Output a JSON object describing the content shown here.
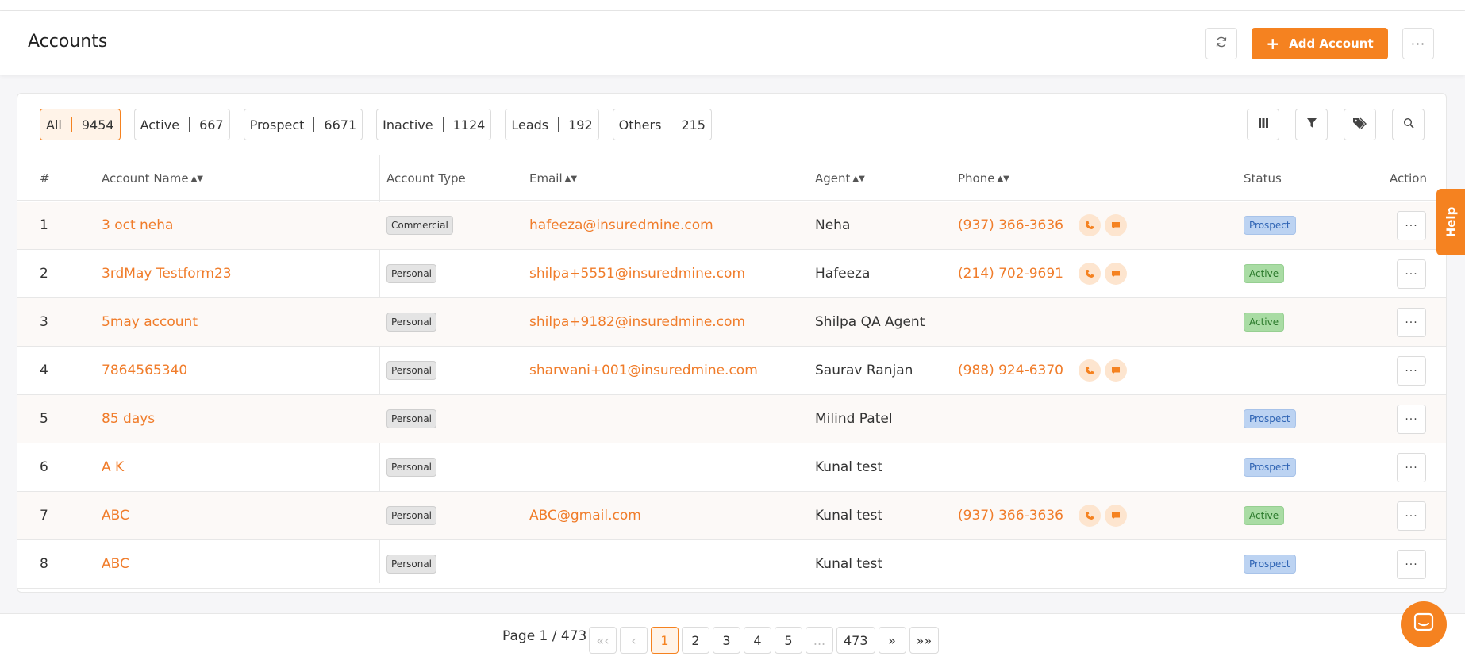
{
  "header": {
    "title": "Accounts",
    "add_label": "Add Account"
  },
  "filters": [
    {
      "label": "All",
      "count": "9454",
      "active": true
    },
    {
      "label": "Active",
      "count": "667"
    },
    {
      "label": "Prospect",
      "count": "6671"
    },
    {
      "label": "Inactive",
      "count": "1124"
    },
    {
      "label": "Leads",
      "count": "192"
    },
    {
      "label": "Others",
      "count": "215"
    }
  ],
  "columns": {
    "num": "#",
    "name": "Account Name",
    "type": "Account Type",
    "email": "Email",
    "agent": "Agent",
    "phone": "Phone",
    "status": "Status",
    "action": "Action"
  },
  "rows": [
    {
      "num": "1",
      "name": "3 oct neha",
      "type": "Commercial",
      "email": "hafeeza@insuredmine.com",
      "agent": "Neha",
      "phone": "(937) 366-3636",
      "status": "Prospect"
    },
    {
      "num": "2",
      "name": "3rdMay Testform23",
      "type": "Personal",
      "email": "shilpa+5551@insuredmine.com",
      "agent": "Hafeeza",
      "phone": "(214) 702-9691",
      "status": "Active"
    },
    {
      "num": "3",
      "name": "5may account",
      "type": "Personal",
      "email": "shilpa+9182@insuredmine.com",
      "agent": "Shilpa QA Agent",
      "phone": "",
      "status": "Active"
    },
    {
      "num": "4",
      "name": "7864565340",
      "type": "Personal",
      "email": "sharwani+001@insuredmine.com",
      "agent": "Saurav Ranjan",
      "phone": "(988) 924-6370",
      "status": ""
    },
    {
      "num": "5",
      "name": "85 days",
      "type": "Personal",
      "email": "",
      "agent": "Milind Patel",
      "phone": "",
      "status": "Prospect"
    },
    {
      "num": "6",
      "name": "A K",
      "type": "Personal",
      "email": "",
      "agent": "Kunal test",
      "phone": "",
      "status": "Prospect"
    },
    {
      "num": "7",
      "name": "ABC",
      "type": "Personal",
      "email": "ABC@gmail.com",
      "agent": "Kunal test",
      "phone": "(937) 366-3636",
      "status": "Active"
    },
    {
      "num": "8",
      "name": "ABC",
      "type": "Personal",
      "email": "",
      "agent": "Kunal test",
      "phone": "",
      "status": "Prospect"
    }
  ],
  "pagination": {
    "info": "Page 1 / 473",
    "first": "«‹",
    "prev": "‹",
    "pages": [
      "1",
      "2",
      "3",
      "4",
      "5",
      "...",
      "473"
    ],
    "current": "1",
    "next": "»",
    "last": "»»"
  },
  "help_label": "Help",
  "colors": {
    "accent": "#f58220",
    "link": "#f07c2a"
  }
}
